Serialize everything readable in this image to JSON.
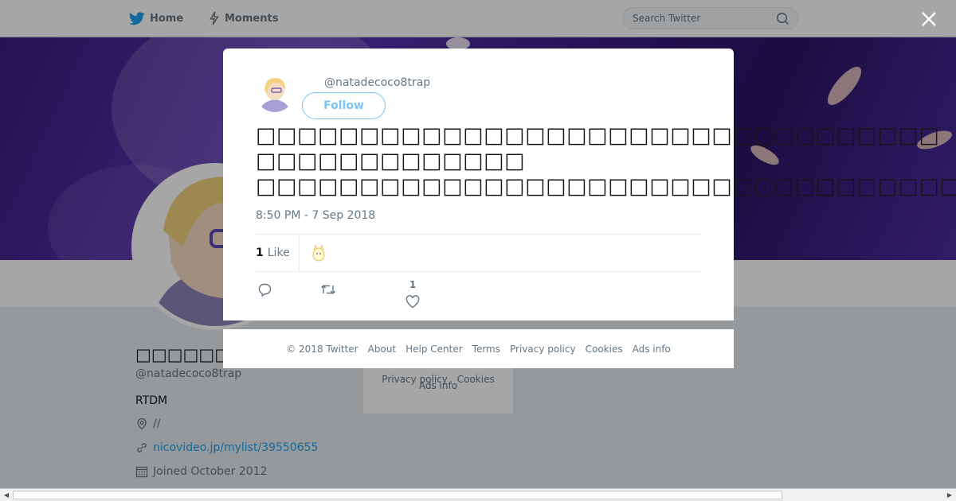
{
  "nav": {
    "home_label": "Home",
    "moments_label": "Moments",
    "search_placeholder": "Search Twitter"
  },
  "profile": {
    "name": "□□□□□□",
    "handle": "@natadecoco8trap",
    "bio": "RTDM",
    "location": "//",
    "website": "nicovideo.jp/mylist/39550655",
    "joined": "Joined October 2012"
  },
  "background_footer": {
    "row1": [
      "Privacy policy",
      "Cookies"
    ],
    "row2": [
      "Ads info"
    ]
  },
  "tweet": {
    "handle": "@natadecoco8trap",
    "follow_label": "Follow",
    "text": "□□□□□□□□□□□□□□□□□□□□□□□□□□□□□□□□□\n□□□□□□□□□□□□□\n□□□□□□□□□□□□□□□□□□□□□□□□□□□□□□□□□□□□□□□□□□□□□□□□□□□",
    "timestamp": "8:50 PM - 7 Sep 2018",
    "like_count": "1",
    "like_word": "Like",
    "action_like_count": "1"
  },
  "footer": {
    "copyright": "© 2018 Twitter",
    "about": "About",
    "help": "Help Center",
    "terms": "Terms",
    "privacy": "Privacy policy",
    "cookies": "Cookies",
    "ads": "Ads info"
  },
  "colors": {
    "brand": "#1da1f2",
    "text_secondary": "#657786"
  }
}
